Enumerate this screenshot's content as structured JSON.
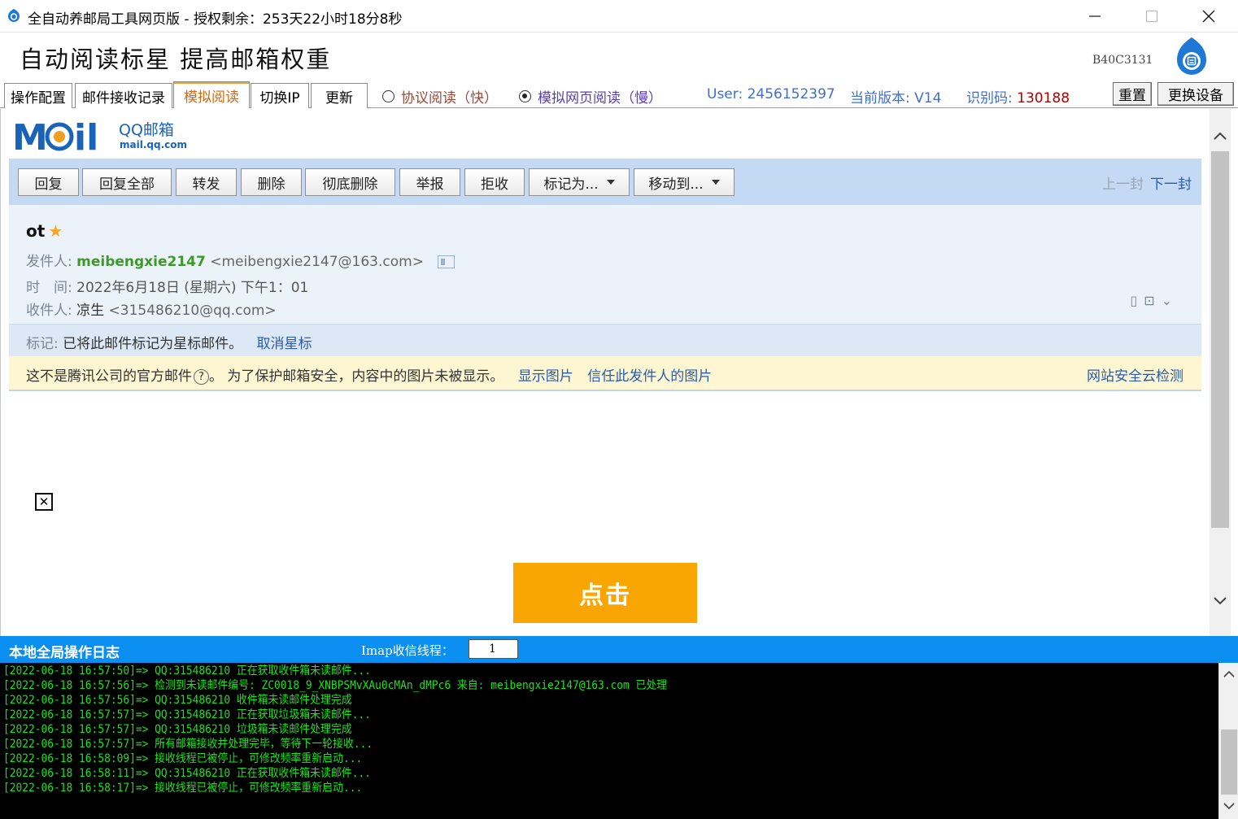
{
  "window": {
    "title": "全自动养邮局工具网页版 - 授权剩余：253天22小时18分8秒"
  },
  "banner": {
    "slogan": "自动阅读标星  提高邮箱权重",
    "code": "B40C3131"
  },
  "tabs": [
    {
      "label": "操作配置",
      "active": false
    },
    {
      "label": "邮件接收记录",
      "active": false
    },
    {
      "label": "模拟阅读",
      "active": true
    },
    {
      "label": "切换IP",
      "active": false
    },
    {
      "label": "更新",
      "active": false
    }
  ],
  "modes": [
    {
      "label": "协议阅读（快）",
      "selected": false
    },
    {
      "label": "模拟网页阅读（慢）",
      "selected": true
    }
  ],
  "status": {
    "user": "User: 2456152397",
    "version": "当前版本: V14",
    "id_label": "识别码: ",
    "id_value": "130188",
    "reset_label": "重置",
    "change_device_label": "更换设备"
  },
  "qqmail": {
    "brand": "QQ邮箱",
    "domain": "mail.qq.com"
  },
  "toolbar": {
    "buttons": [
      "回复",
      "回复全部",
      "转发",
      "删除",
      "彻底删除",
      "举报",
      "拒收",
      "标记为...",
      "移动到..."
    ],
    "prev": "上一封",
    "next": "下一封"
  },
  "mail": {
    "subject": "ot",
    "from_label": "发件人:",
    "from_name": "meibengxie2147",
    "from_addr": "<meibengxie2147@163.com>",
    "time_label": "时　间:",
    "time_value": "2022年6月18日 (星期六) 下午1：01",
    "to_label": "收件人:",
    "to_name": "凉生",
    "to_addr": "<315486210@qq.com>",
    "mark_label": "标记:",
    "mark_text": "已将此邮件标记为星标邮件。",
    "mark_link": "取消星标",
    "warning_a": "这不是腾讯公司的官方邮件",
    "warning_q": "?",
    "warning_b": "。 为了保护邮箱安全，内容中的图片未被显示。",
    "show_images": "显示图片",
    "trust_images": "信任此发件人的图片",
    "security_check": "网站安全云检测",
    "click_button": "点击"
  },
  "log": {
    "title": "本地全局操作日志",
    "imap_label": "Imap收信线程：",
    "imap_threads": "1",
    "lines": [
      "[2022-06-18 16:57:50]=> QQ:315486210 正在获取收件箱未读邮件...",
      "[2022-06-18 16:57:56]=> 检测到未读邮件编号: ZC0018_9_XNBPSMvXAu0cMAn_dMPc6 来自: meibengxie2147@163.com 已处理",
      "[2022-06-18 16:57:56]=> QQ:315486210 收件箱未读邮件处理完成",
      "[2022-06-18 16:57:57]=> QQ:315486210 正在获取垃圾箱未读邮件...",
      "[2022-06-18 16:57:57]=> QQ:315486210 垃圾箱未读邮件处理完成",
      "[2022-06-18 16:57:57]=> 所有邮箱接收并处理完毕，等待下一轮接收...",
      "[2022-06-18 16:58:09]=> 接收线程已被停止，可修改频率重新启动...",
      "[2022-06-18 16:58:11]=> QQ:315486210 正在获取收件箱未读邮件...",
      "[2022-06-18 16:58:17]=> 接收线程已被停止，可修改频率重新启动..."
    ]
  },
  "colors": {
    "accent_blue": "#0a8ef0",
    "tab_active": "#d06a12",
    "log_text": "#17e617",
    "click_orange": "#f9a602"
  }
}
